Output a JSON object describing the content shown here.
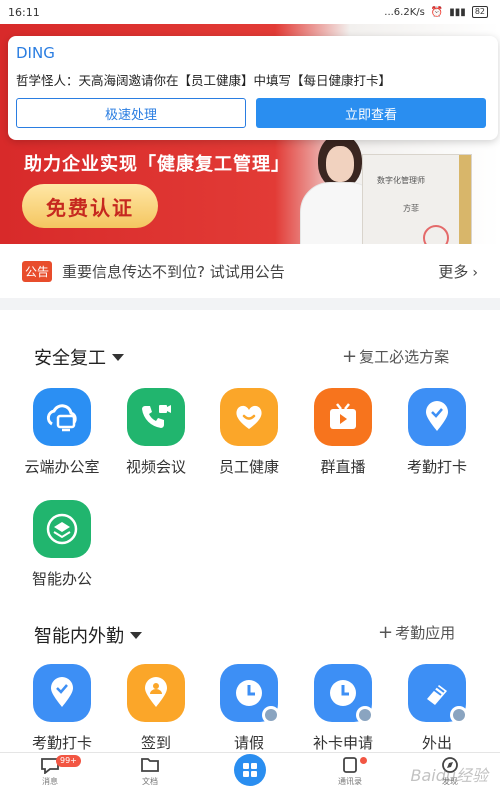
{
  "status": {
    "time": "16:11",
    "network": "...6.2K/s",
    "battery": "82"
  },
  "banner": {
    "subtitle": "助力企业实现「健康复工管理」",
    "button_label": "免费认证",
    "cert_title": "数字化管理师",
    "cert_name": "方菲"
  },
  "ding": {
    "title": "DING",
    "message": "哲学怪人：天高海阔邀请你在【员工健康】中填写【每日健康打卡】",
    "btn_quick": "极速处理",
    "btn_view": "立即查看"
  },
  "notice": {
    "tag": "公告",
    "text": "重要信息传达不到位? 试试用公告",
    "more": "更多"
  },
  "section1": {
    "title": "安全复工",
    "action": "复工必选方案",
    "apps": [
      {
        "label": "云端办公室",
        "color": "#2b8ff3"
      },
      {
        "label": "视频会议",
        "color": "#21b56e"
      },
      {
        "label": "员工健康",
        "color": "#fba629"
      },
      {
        "label": "群直播",
        "color": "#f7741d"
      },
      {
        "label": "考勤打卡",
        "color": "#3d8ff5"
      },
      {
        "label": "智能办公",
        "color": "#21b56e"
      }
    ]
  },
  "section2": {
    "title": "智能内外勤",
    "action": "考勤应用",
    "apps": [
      {
        "label": "考勤打卡",
        "color": "#3d8ff5"
      },
      {
        "label": "签到",
        "color": "#fba629"
      },
      {
        "label": "请假",
        "color": "#3d8ff5"
      },
      {
        "label": "补卡申请",
        "color": "#3d8ff5"
      },
      {
        "label": "外出",
        "color": "#3d8ff5"
      }
    ]
  },
  "tabbar": {
    "messages": "消息",
    "messages_badge": "99+",
    "docs": "文档",
    "contacts": "通讯录",
    "discover": "发现",
    "watermark": "Baidu经验"
  }
}
